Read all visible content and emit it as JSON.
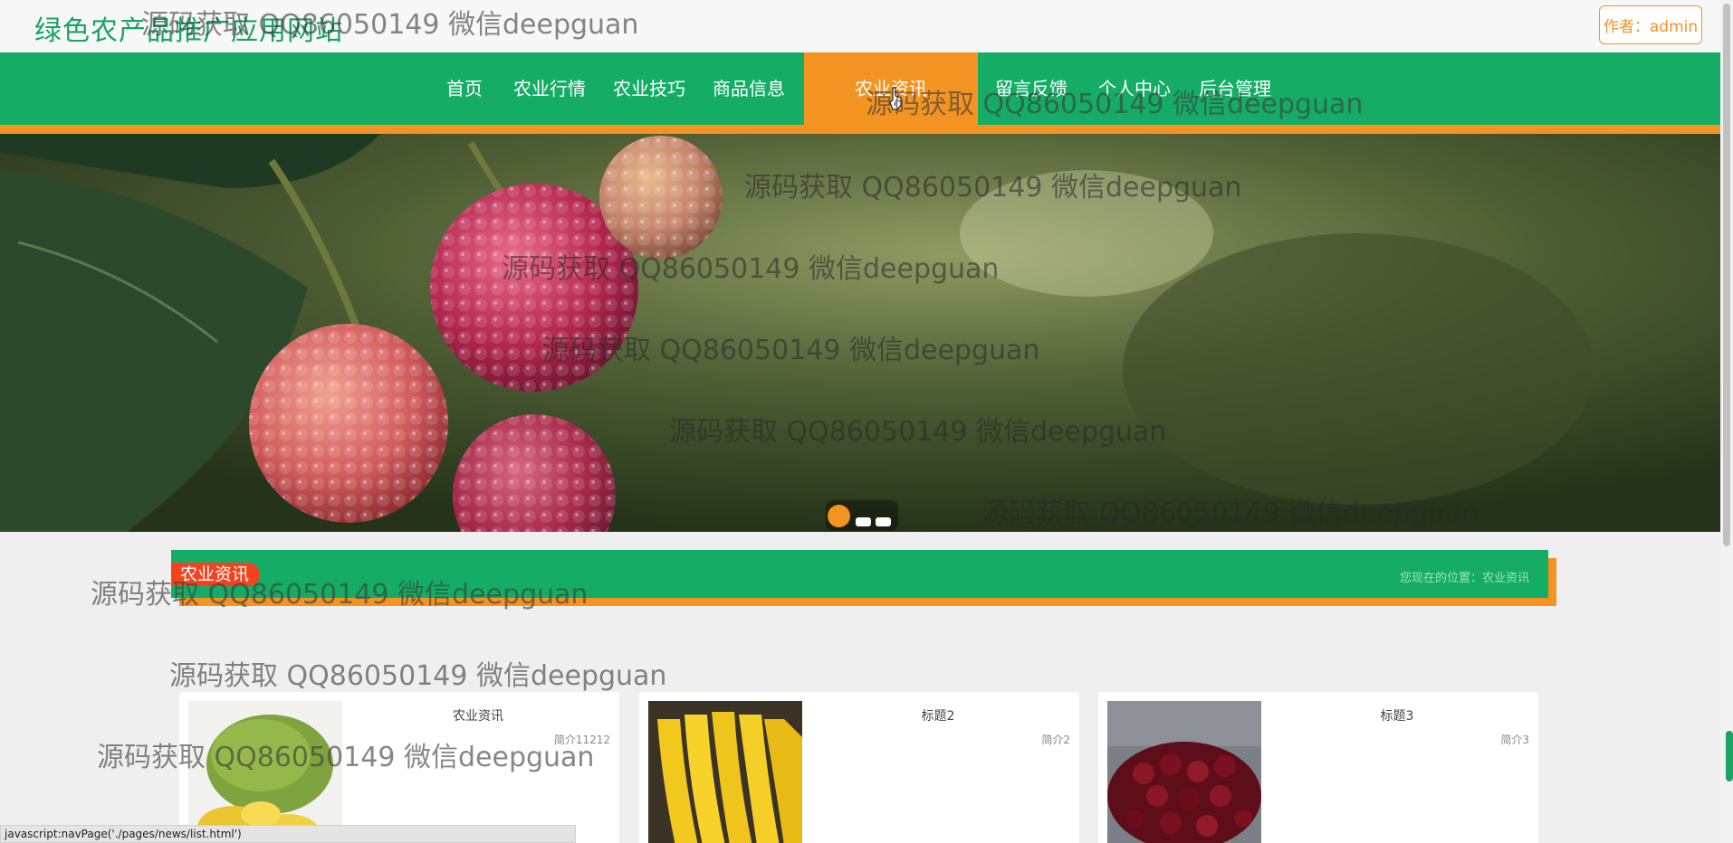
{
  "header": {
    "site_title": "绿色农产品推广应用网站",
    "author_label": "作者：admin"
  },
  "nav": {
    "items": [
      {
        "label": "首页"
      },
      {
        "label": "农业行情"
      },
      {
        "label": "农业技巧"
      },
      {
        "label": "商品信息"
      },
      {
        "label": "农业资讯",
        "active": true
      },
      {
        "label": "留言反馈"
      },
      {
        "label": "个人中心"
      },
      {
        "label": "后台管理"
      }
    ]
  },
  "banner": {
    "slide_count": 3,
    "active_slide": 1
  },
  "section": {
    "badge": "农业资讯",
    "breadcrumb": "您现在的位置：农业资讯"
  },
  "cards": [
    {
      "title": "农业资讯",
      "brief": "简介11212",
      "image": "jackfruit"
    },
    {
      "title": "标题2",
      "brief": "简介2",
      "image": "bananas"
    },
    {
      "title": "标题3",
      "brief": "简介3",
      "image": "cherries"
    }
  ],
  "watermark_text": "源码获取 QQ86050149 微信deepguan",
  "status_bar": "javascript:navPage('./pages/news/list.html')",
  "colors": {
    "primary_green": "#15ad66",
    "accent_orange": "#f39322",
    "badge_red": "#f5421e"
  }
}
